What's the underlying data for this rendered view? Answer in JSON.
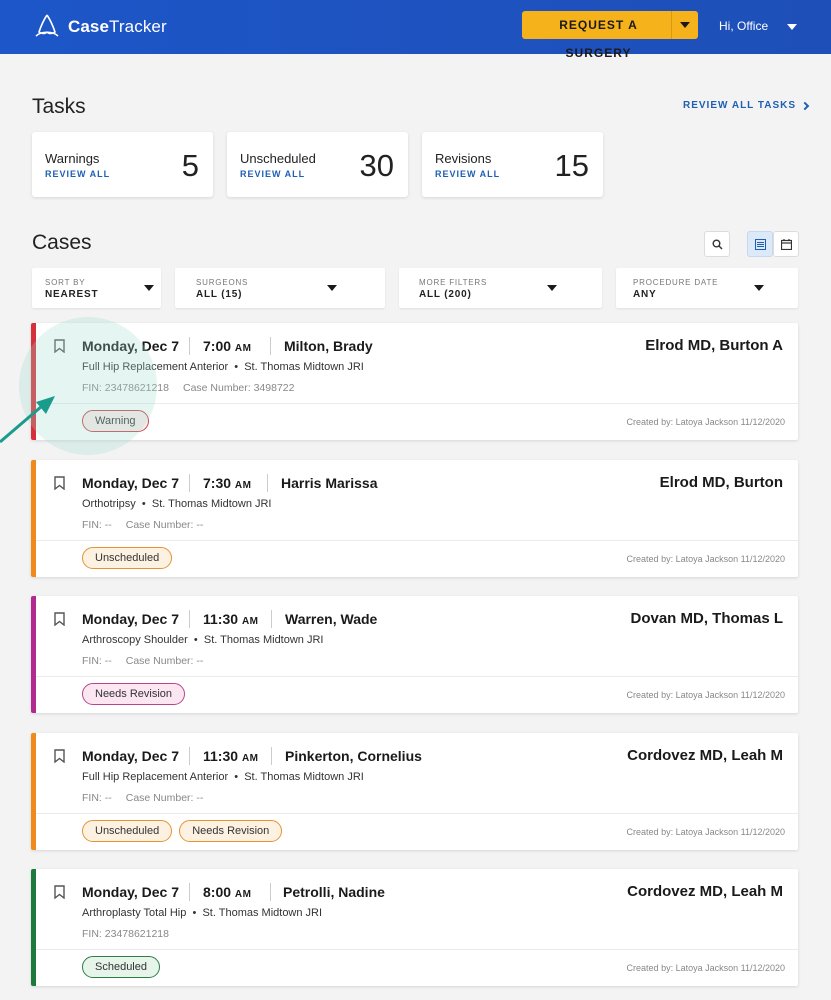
{
  "header": {
    "brand_bold": "Case",
    "brand_rest": "Tracker",
    "request_button": "REQUEST A SURGERY",
    "user_greeting": "Hi, Office"
  },
  "tasks": {
    "title": "Tasks",
    "review_all_tasks": "REVIEW ALL TASKS",
    "cards": [
      {
        "label": "Warnings",
        "link": "REVIEW ALL",
        "count": "5"
      },
      {
        "label": "Unscheduled",
        "link": "REVIEW ALL",
        "count": "30"
      },
      {
        "label": "Revisions",
        "link": "REVIEW ALL",
        "count": "15"
      }
    ]
  },
  "cases": {
    "title": "Cases",
    "filters": [
      {
        "label": "SORT BY",
        "value": "NEAREST"
      },
      {
        "label": "SURGEONS",
        "value": "ALL (15)"
      },
      {
        "label": "MORE FILTERS",
        "value": "ALL (200)"
      },
      {
        "label": "PROCEDURE DATE",
        "value": "ANY"
      }
    ],
    "list": [
      {
        "date": "Monday, Dec 7",
        "time": "7:00",
        "ampm": "AM",
        "patient": "Milton, Brady",
        "doctor": "Elrod MD, Burton A",
        "procedure": "Full Hip Replacement Anterior",
        "location": "St. Thomas Midtown JRI",
        "fin": "FIN: 23478621218",
        "case_number": "Case Number: 3498722",
        "badges": [
          "Warning"
        ],
        "created": "Created by: Latoya Jackson 11/12/2020",
        "stripe": "#d6303a"
      },
      {
        "date": "Monday, Dec 7",
        "time": "7:30",
        "ampm": "AM",
        "patient": "Harris Marissa",
        "doctor": "Elrod MD, Burton",
        "procedure": "Orthotripsy",
        "location": "St. Thomas Midtown JRI",
        "fin": "FIN: --",
        "case_number": "Case Number: --",
        "badges": [
          "Unscheduled"
        ],
        "created": "Created by: Latoya Jackson 11/12/2020",
        "stripe": "#f08a1c"
      },
      {
        "date": "Monday, Dec 7",
        "time": "11:30",
        "ampm": "AM",
        "patient": "Warren, Wade",
        "doctor": "Dovan MD, Thomas L",
        "procedure": "Arthroscopy Shoulder",
        "location": "St. Thomas Midtown JRI",
        "fin": "FIN: --",
        "case_number": "Case Number: --",
        "badges": [
          "Needs Revision"
        ],
        "created": "Created by: Latoya Jackson 11/12/2020",
        "stripe": "#b02a8f"
      },
      {
        "date": "Monday, Dec 7",
        "time": "11:30",
        "ampm": "AM",
        "patient": "Pinkerton, Cornelius",
        "doctor": "Cordovez MD, Leah M",
        "procedure": "Full Hip Replacement Anterior",
        "location": "St. Thomas Midtown JRI",
        "fin": "FIN: --",
        "case_number": "Case Number: --",
        "badges": [
          "Unscheduled",
          "Needs Revision"
        ],
        "created": "Created by: Latoya Jackson 11/12/2020",
        "stripe": "#f08a1c"
      },
      {
        "date": "Monday, Dec 7",
        "time": "8:00",
        "ampm": "AM",
        "patient": "Petrolli, Nadine",
        "doctor": "Cordovez MD, Leah M",
        "procedure": "Arthroplasty Total Hip",
        "location": "St. Thomas Midtown JRI",
        "fin": "FIN: 23478621218",
        "case_number": "",
        "badges": [
          "Scheduled"
        ],
        "created": "Created by: Latoya Jackson 11/12/2020",
        "stripe": "#1e7a3c"
      }
    ]
  },
  "colors": {
    "header_blue": "#1d56c8",
    "accent_yellow": "#f6b21b",
    "link_blue": "#1f5fb3"
  }
}
